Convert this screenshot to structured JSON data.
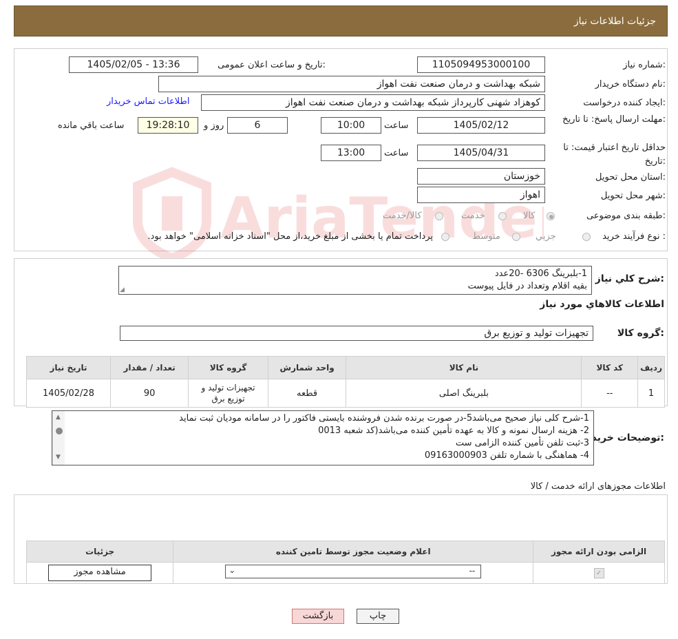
{
  "header": {
    "title": "جزئیات اطلاعات نیاز"
  },
  "labels": {
    "need_number": "شماره نیاز:",
    "announce_datetime": "تاریخ و ساعت اعلان عمومی:",
    "buyer_org": "نام دستگاه خریدار:",
    "requester": "ایجاد کننده درخواست:",
    "reply_deadline": "مهلت ارسال پاسخ: تا تاریخ:",
    "price_validity": "حداقل تاریخ اعتبار قیمت: تا تاریخ:",
    "time": "ساعت",
    "day_and": "روز و",
    "remaining_time": "ساعت باقي مانده",
    "province": "استان محل تحویل:",
    "city": "شهر محل تحویل:",
    "category": "طبقه بندی موضوعی:",
    "purchase_type": "نوع فرآیند خرید :",
    "general_desc": "شرح کلي نياز:",
    "goods_info": "اطلاعات کالاهاي مورد نياز",
    "goods_group": "گروه کالا:",
    "buyer_notes": "توضیحات خریدار:",
    "license_info": "اطلاعات مجوزهای ارائه خدمت / کالا"
  },
  "values": {
    "need_number": "1105094953000100",
    "announce_datetime": "1405/02/05 - 13:36",
    "buyer_org": "شبکه بهداشت و درمان صنعت نفت اهواز",
    "requester": "کوهزاد شهنی کارپرداز شبکه بهداشت و درمان صنعت نفت اهواز",
    "contact_link": "اطلاعات تماس خریدار",
    "reply_date": "1405/02/12",
    "reply_time": "10:00",
    "reply_days": "6",
    "reply_remaining": "19:28:10",
    "validity_date": "1405/04/31",
    "validity_time": "13:00",
    "province": "خوزستان",
    "city": "اهواز",
    "goods_group": "تجهیزات تولید و توزیع برق"
  },
  "category_options": [
    "کالا",
    "خدمت",
    "کالا/خدمت"
  ],
  "purchase_options": [
    "جزيي",
    "متوسط"
  ],
  "purchase_note": "پرداخت تمام یا بخشی از مبلغ خرید،از محل \"اسناد خزانه اسلامی\" خواهد بود.",
  "general_desc_lines": [
    "1-بلبرینگ 6306 -20عدد",
    "بقیه اقلام وتعداد در فایل پیوست"
  ],
  "goods_table": {
    "headers": [
      "رديف",
      "کد کالا",
      "نام کالا",
      "واحد شمارش",
      "گروه کالا",
      "تعداد / مقدار",
      "تاریخ نیاز"
    ],
    "rows": [
      [
        "1",
        "--",
        "بلبرینگ اصلی",
        "قطعه",
        "تجهیزات تولید و توزیع برق",
        "90",
        "1405/02/28"
      ]
    ]
  },
  "buyer_notes_lines": [
    "1-شرح کلی نیاز صحیح می‌باشد5-در صورت برنده شدن فروشنده بایستی فاکتور را در سامانه مودیان ثبت نماید",
    "2- هزینه ارسال نمونه و کالا به عهده تأمین کننده می‌باشد(کد شعبه 0013",
    "3-ثبت تلفن تأمین کننده الزامی ست",
    "4- هماهنگی با شماره تلفن 09163000903"
  ],
  "license_table": {
    "headers": [
      "الزامی بودن ارائه مجوز",
      "اعلام وضعیت مجوز توسط تامین کننده",
      "جزئیات"
    ],
    "select_value": "--",
    "view_button": "مشاهده مجوز"
  },
  "buttons": {
    "print": "چاپ",
    "back": "بازگشت"
  },
  "watermark_text": "AriaTender.neT",
  "colors": {
    "header_bg": "#8a6c3e",
    "back_button_bg": "#f8d7d7",
    "link": "#1a1aff"
  }
}
